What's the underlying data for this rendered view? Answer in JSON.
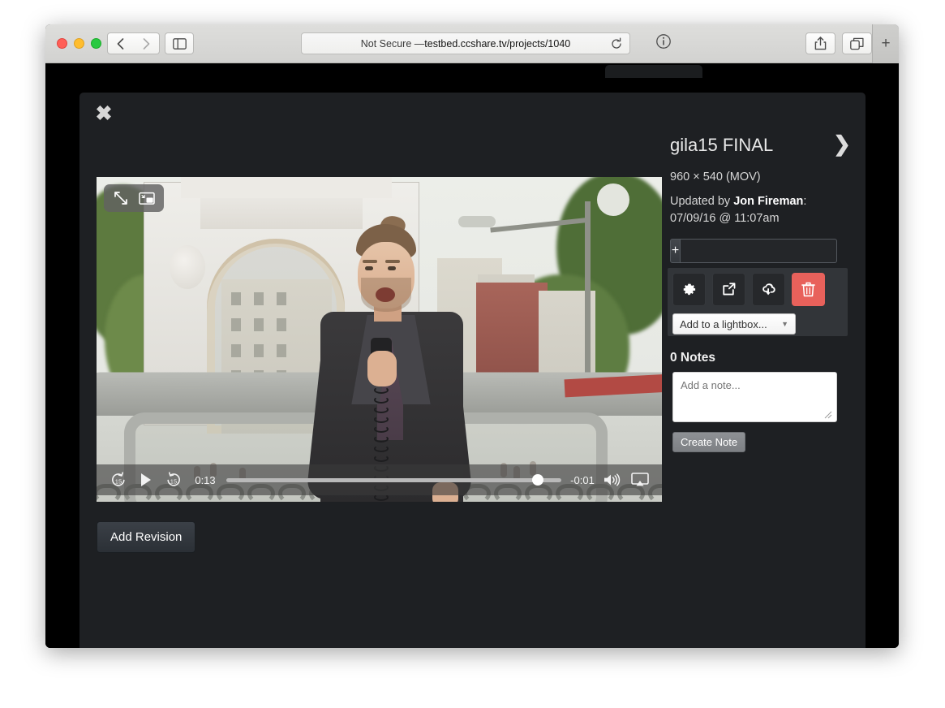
{
  "browser": {
    "url_prefix": "Not Secure — ",
    "url_host": "testbed.ccshare.tv/projects/1040",
    "back_icon": "chevron-left-icon",
    "forward_icon": "chevron-right-icon",
    "sidebar_icon": "sidebar-toggle-icon",
    "reload_icon": "reload-icon",
    "info_icon": "info-icon",
    "share_icon": "share-icon",
    "tabs_icon": "show-tabs-icon",
    "new_tab_label": "+"
  },
  "modal": {
    "close_label": "✖"
  },
  "video": {
    "overlay": {
      "fullscreen_icon": "fullscreen-icon",
      "pip_icon": "picture-in-picture-icon"
    },
    "controls": {
      "skip_back_label": "15",
      "play_icon": "play-icon",
      "skip_forward_label": "15",
      "current_time": "0:13",
      "remaining_time": "-0:01",
      "progress_percent": 93,
      "volume_icon": "volume-high-icon",
      "airplay_icon": "airplay-icon"
    }
  },
  "actions": {
    "add_revision_label": "Add Revision"
  },
  "panel": {
    "title": "gila15 FINAL",
    "next_arrow": "❯",
    "dimensions": "960 × 540 (MOV)",
    "updated_prefix": "Updated by ",
    "updated_user": "Jon Fireman",
    "updated_suffix": ":",
    "updated_date": "07/09/16 @ 11:07am",
    "tag_add_label": "+",
    "tag_value": "",
    "tag_placeholder": "",
    "buttons": [
      {
        "name": "settings-button",
        "icon": "gear-icon"
      },
      {
        "name": "share-button",
        "icon": "share-external-icon"
      },
      {
        "name": "download-button",
        "icon": "download-cloud-icon"
      },
      {
        "name": "delete-button",
        "icon": "trash-icon"
      }
    ],
    "lightbox_label": "Add to a lightbox...",
    "lightbox_caret": "▼",
    "notes_heading": "0 Notes",
    "note_placeholder": "Add a note...",
    "note_value": "",
    "create_note_label": "Create Note"
  },
  "colors": {
    "modal_bg": "#1e2023",
    "page_bg": "#000000",
    "danger": "#e8615b",
    "panel_group_bg": "#323539",
    "accent_text": "#ffffff"
  }
}
